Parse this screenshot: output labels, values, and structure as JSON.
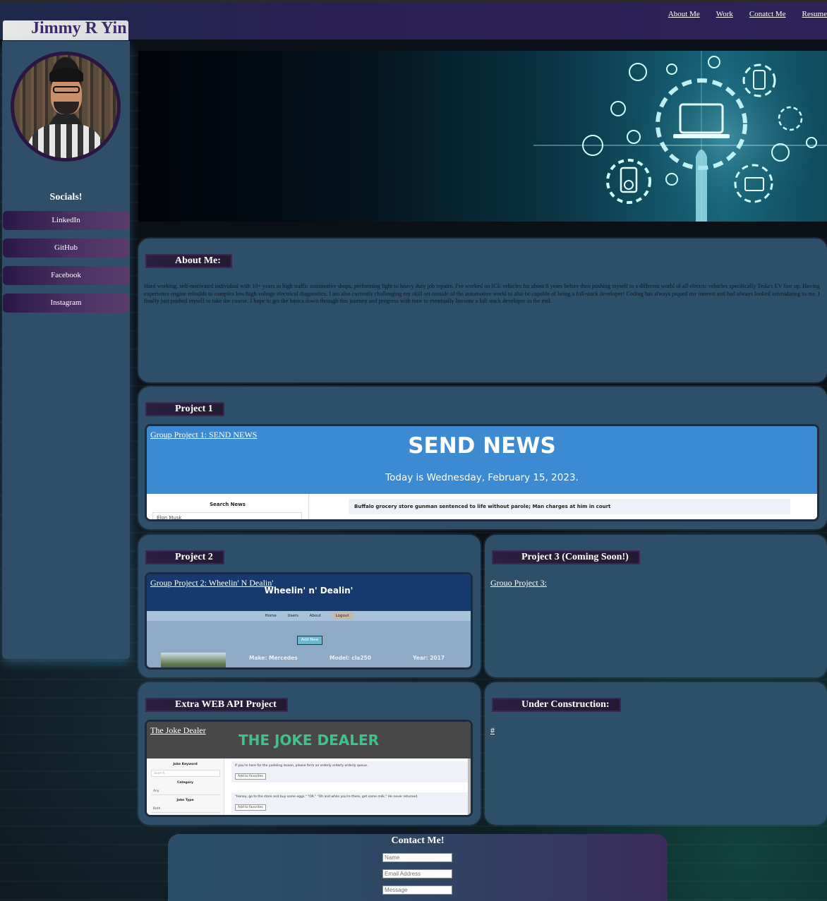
{
  "header": {
    "site_title": "Jimmy R Yin",
    "nav": [
      "About Me",
      "Work",
      "Conatct Me",
      "Resume"
    ]
  },
  "sidebar": {
    "socials_title": "Socials!",
    "links": [
      "LinkedIn",
      "GitHub",
      "Facebook",
      "Instagram"
    ]
  },
  "about": {
    "title": "About Me:",
    "body": "Hard working, self-motivated individual with 10+ years in high traffic automotive shops, performing light to heavy duty job repairs. I've worked on ICE vehicles for about 8 years before then pushing myself to a different world of all electric vehicles specifically Tesla's EV line up. Having experience engine rebuilds to complex low/high voltage electrical diagnostics. I am also currently challenging my skill set outside of the automotive world to also be capable of being a full-stack developer! Coding has always piqued my interest and had always looked intimidating to me. I finally just pushed myself to take the course. I hope to get the basics down through this journey and progress with time to eventually become a full stack developer in the end."
  },
  "project1": {
    "title": "Project 1",
    "link": "Group Project 1: SEND NEWS",
    "shot": {
      "heading": "SEND NEWS",
      "date": "Today is Wednesday, February 15, 2023.",
      "search_label": "Search News",
      "search_value": "Elon Musk",
      "headline": "Buffalo grocery store gunman sentenced to life without parole; Man charges at him in court"
    }
  },
  "project2": {
    "title": "Project 2",
    "link": "Group Project 2: Wheelin' N Dealin'",
    "shot": {
      "heading": "Wheelin' n' Dealin'",
      "nav": [
        "Home",
        "Users",
        "About",
        "Logout"
      ],
      "add_button": "Add New",
      "make": "Make: Mercedes",
      "model": "Model: cla250",
      "year": "Year: 2017"
    }
  },
  "project3": {
    "title": "Project 3 (Coming Soon!)",
    "link": "Grouo Project 3:"
  },
  "extra": {
    "title": "Extra WEB API Project",
    "link": "The Joke Dealer",
    "shot": {
      "heading": "THE JOKE DEALER",
      "keyword_label": "Joke Keyword",
      "keyword_placeholder": "Search",
      "category_label": "Category",
      "category_value": "Any",
      "type_label": "Joke Type",
      "type_value": "Both",
      "joke1": "If you're here for the yodeling lesson, please form an orderly orderly orderly queue.",
      "joke2": "\"Honey, go to the store and buy some eggs.\" \"OK.\" \"Oh and while you're there, get some milk.\" He never returned.",
      "fav_button": "Add to favorites"
    }
  },
  "construction": {
    "title": "Under Construction:",
    "link": "#"
  },
  "contact": {
    "title": "Contact Me!",
    "name_placeholder": "Name",
    "email_placeholder": "Email Address",
    "message_placeholder": "Message"
  },
  "colors": {
    "card": "#2d4f67",
    "header": "#2a1f52",
    "accent_purple": "#3a2752",
    "send_news_blue": "#3b8ad2",
    "joke_green": "#3fc38a"
  }
}
